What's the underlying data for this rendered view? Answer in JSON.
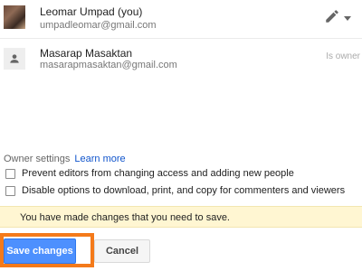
{
  "users": [
    {
      "name": "Leomar Umpad (you)",
      "email": "umpadleomar@gmail.com",
      "avatar": "photo",
      "permission_icons": [
        "pencil-icon",
        "dropdown-arrow-icon"
      ]
    },
    {
      "name": "Masarap Masaktan",
      "email": "masarapmasaktan@gmail.com",
      "avatar": "person-icon",
      "permission_label": "Is owner"
    }
  ],
  "owner_settings": {
    "label": "Owner settings",
    "learn_more": "Learn more",
    "options": [
      {
        "label": "Prevent editors from changing access and adding new people",
        "checked": false
      },
      {
        "label": "Disable options to download, print, and copy for commenters and viewers",
        "checked": false
      }
    ]
  },
  "banner": {
    "message": "You have made changes that you need to save.",
    "color": "#fff6d2"
  },
  "buttons": {
    "save": "Save changes",
    "cancel": "Cancel"
  },
  "colors": {
    "primary_button": "#4d90fe",
    "link": "#1155cc",
    "highlight": "#f47a1a"
  }
}
